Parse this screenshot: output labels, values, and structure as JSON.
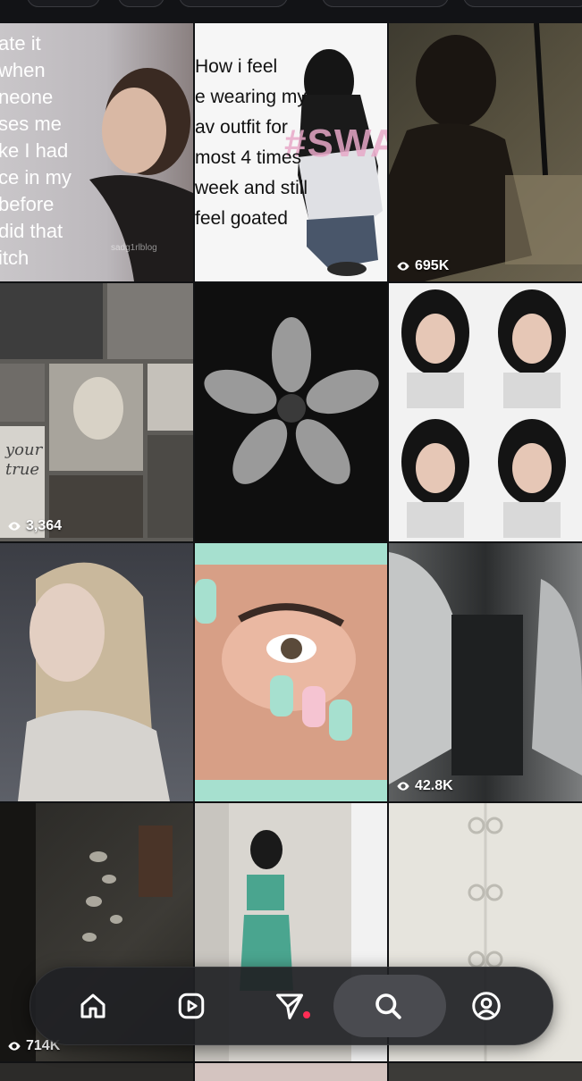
{
  "meme_post": {
    "lines": [
      "ate it",
      "when",
      "neone",
      "ses me",
      "ke I had",
      "ce in my",
      "before",
      "did that",
      "itch"
    ],
    "watermark": "sadg1rlblog"
  },
  "swag_post": {
    "lines": [
      "How i feel",
      "e wearing my",
      "av outfit for",
      "most 4 times",
      "week and still",
      "feel goated"
    ],
    "overlay": "#SWAG"
  },
  "mirror_post": {
    "handwriting": [
      "your",
      "true"
    ]
  },
  "view_counts": {
    "tile_3": "695K",
    "tile_4": "3,364",
    "tile_9": "42.8K",
    "tile_10": "714K"
  },
  "nav": {
    "items": [
      "home",
      "reels",
      "messages",
      "explore",
      "profile"
    ],
    "active": "explore",
    "messages_has_notification": true
  },
  "colors": {
    "background": "#111214",
    "nav_bg": "#202124",
    "active_pill": "#4a4b50",
    "notification_dot": "#ff2d55"
  }
}
